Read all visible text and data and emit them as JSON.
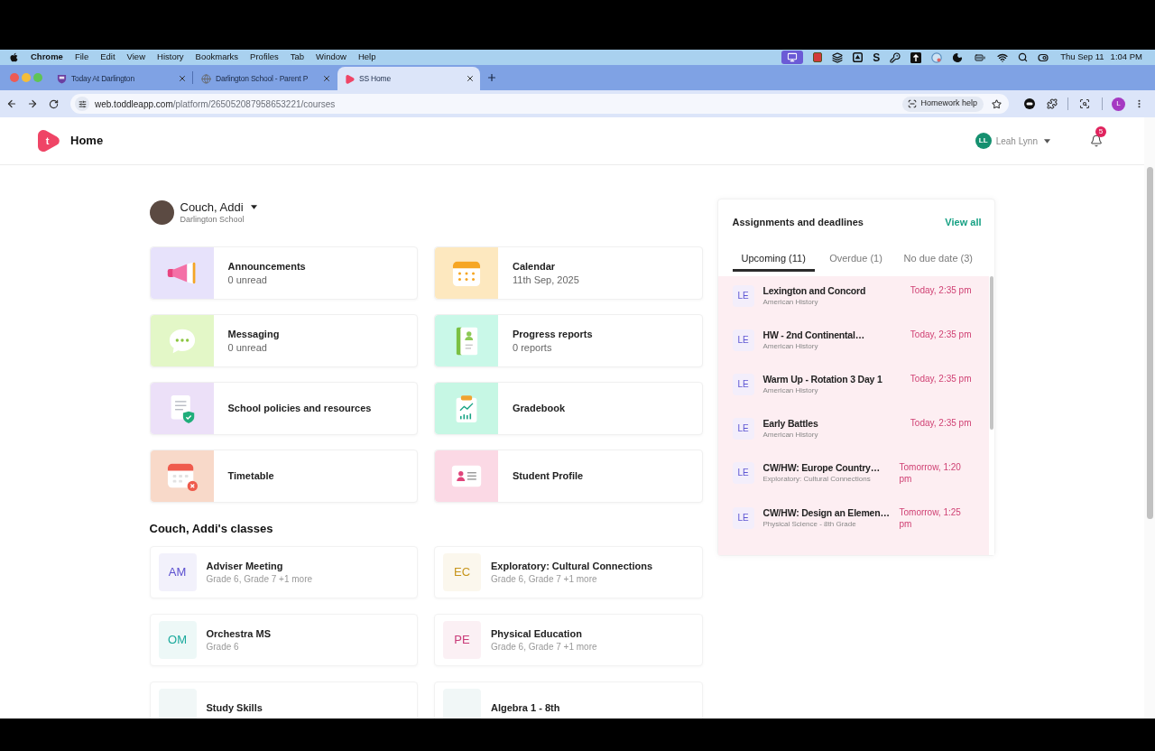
{
  "menu_bar": {
    "app": "Chrome",
    "items": [
      "File",
      "Edit",
      "View",
      "History",
      "Bookmarks",
      "Profiles",
      "Tab",
      "Window",
      "Help"
    ],
    "status_glyph": "S",
    "date": "Thu Sep 11",
    "time": "1:04 PM"
  },
  "browser_tabs": [
    {
      "title": "Today At Darlington",
      "selected": false
    },
    {
      "title": "Darlington School - Parent P",
      "selected": false
    },
    {
      "title": "SS Home",
      "selected": true
    }
  ],
  "address_bar": {
    "domain": "web.toddleapp.com",
    "path": "/platform/265052087958653221/courses",
    "chip": "Homework help",
    "profile_initial": "L"
  },
  "header": {
    "logo_letter": "t",
    "title": "Home",
    "user_initials": "LL",
    "user_name": "Leah Lynn",
    "notification_count": "5"
  },
  "student": {
    "name": "Couch, Addi",
    "school": "Darlington School"
  },
  "tiles": [
    {
      "title": "Announcements",
      "subtitle": "0 unread"
    },
    {
      "title": "Calendar",
      "subtitle": "11th Sep, 2025"
    },
    {
      "title": "Messaging",
      "subtitle": "0 unread"
    },
    {
      "title": "Progress reports",
      "subtitle": "0 reports"
    },
    {
      "title": "School policies and resources"
    },
    {
      "title": "Gradebook"
    },
    {
      "title": "Timetable"
    },
    {
      "title": "Student Profile"
    }
  ],
  "classes_heading": "Couch, Addi's classes",
  "classes": [
    {
      "initials": "AM",
      "color": "#5b4fcf",
      "title": "Adviser Meeting",
      "subtitle": "Grade 6, Grade 7 +1 more"
    },
    {
      "initials": "EC",
      "color": "#c7951c",
      "title": "Exploratory: Cultural Connections",
      "subtitle": "Grade 6, Grade 7 +1 more"
    },
    {
      "initials": "OM",
      "color": "#1aa99c",
      "title": "Orchestra MS",
      "subtitle": "Grade 6"
    },
    {
      "initials": "PE",
      "color": "#c93a78",
      "title": "Physical Education",
      "subtitle": "Grade 6, Grade 7 +1 more"
    },
    {
      "title": "Study Skills"
    },
    {
      "title": "Algebra 1 - 8th"
    }
  ],
  "assignments": {
    "title": "Assignments and deadlines",
    "view_all": "View all",
    "tabs": [
      {
        "label": "Upcoming (11)",
        "selected": true
      },
      {
        "label": "Overdue (1)",
        "selected": false
      },
      {
        "label": "No due date (3)",
        "selected": false
      }
    ],
    "items": [
      {
        "initials": "LE",
        "title": "Lexington and Concord",
        "course": "American History",
        "due": "Today, 2:35 pm"
      },
      {
        "initials": "LE",
        "title": "HW - 2nd Continental…",
        "course": "American History",
        "due": "Today, 2:35 pm"
      },
      {
        "initials": "LE",
        "title": "Warm Up - Rotation 3 Day 1",
        "course": "American History",
        "due": "Today, 2:35 pm"
      },
      {
        "initials": "LE",
        "title": "Early Battles",
        "course": "American History",
        "due": "Today, 2:35 pm"
      },
      {
        "initials": "LE",
        "title": "CW/HW: Europe Country…",
        "course": "Exploratory: Cultural Connections",
        "due": "Tomorrow, 1:20 pm"
      },
      {
        "initials": "LE",
        "title": "CW/HW: Design an Elemen…",
        "course": "Physical Science - 8th Grade",
        "due": "Tomorrow, 1:25 pm"
      }
    ]
  }
}
